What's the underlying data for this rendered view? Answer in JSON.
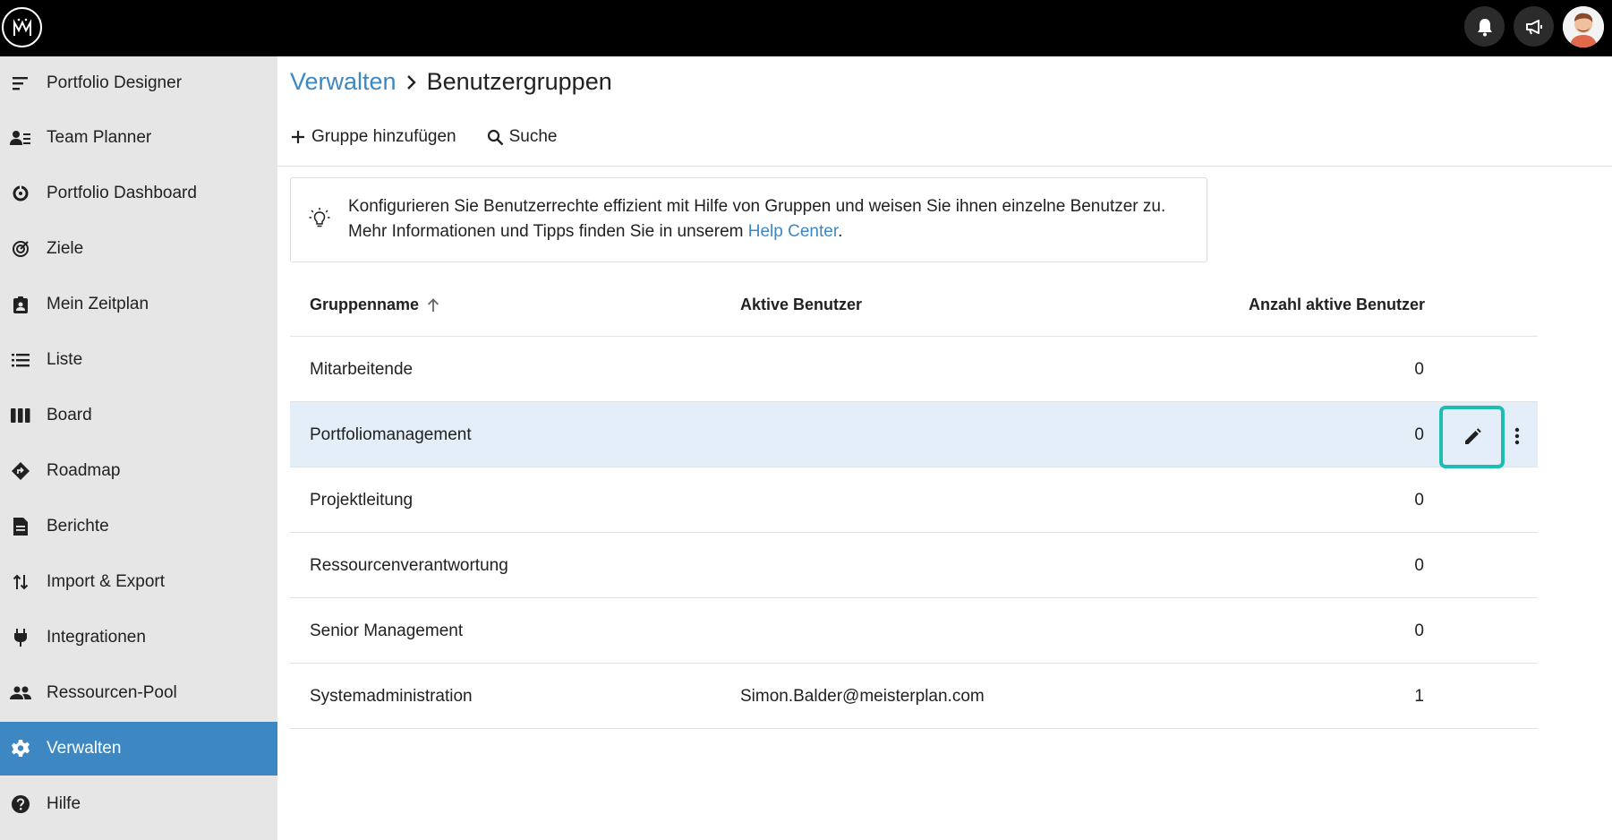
{
  "topbar": {
    "logo_icon": "meisterplan-logo-icon",
    "notifications_icon": "bell-icon",
    "announcements_icon": "megaphone-icon",
    "avatar_icon": "user-avatar"
  },
  "sidebar": {
    "items": [
      {
        "label": "Portfolio Designer",
        "icon": "portfolio-designer-icon"
      },
      {
        "label": "Team Planner",
        "icon": "team-planner-icon"
      },
      {
        "label": "Portfolio Dashboard",
        "icon": "dashboard-icon"
      },
      {
        "label": "Ziele",
        "icon": "target-icon"
      },
      {
        "label": "Mein Zeitplan",
        "icon": "schedule-icon"
      },
      {
        "label": "Liste",
        "icon": "list-icon"
      },
      {
        "label": "Board",
        "icon": "board-icon"
      },
      {
        "label": "Roadmap",
        "icon": "roadmap-icon"
      },
      {
        "label": "Berichte",
        "icon": "report-icon"
      },
      {
        "label": "Import & Export",
        "icon": "import-export-icon"
      },
      {
        "label": "Integrationen",
        "icon": "plug-icon"
      },
      {
        "label": "Ressourcen-Pool",
        "icon": "people-icon"
      },
      {
        "label": "Verwalten",
        "icon": "gear-icon",
        "active": true
      },
      {
        "label": "Hilfe",
        "icon": "help-icon"
      }
    ],
    "active_color": "#3d88c2"
  },
  "breadcrumb": {
    "parent": "Verwalten",
    "current": "Benutzergruppen"
  },
  "toolbar": {
    "add_label": "Gruppe hinzufügen",
    "search_label": "Suche"
  },
  "info": {
    "line1": "Konfigurieren Sie Benutzerrechte effizient mit Hilfe von Gruppen und weisen Sie ihnen einzelne Benutzer zu.",
    "line2_prefix": "Mehr Informationen und Tipps finden Sie in unserem ",
    "link_text": "Help Center",
    "line2_suffix": "."
  },
  "table": {
    "columns": {
      "name": "Gruppenname",
      "active_users": "Aktive Benutzer",
      "count": "Anzahl aktive Benutzer"
    },
    "sort": "ascending",
    "rows": [
      {
        "name": "Mitarbeitende",
        "active_users": "",
        "count": "0"
      },
      {
        "name": "Portfoliomanagement",
        "active_users": "",
        "count": "0",
        "highlighted": true
      },
      {
        "name": "Projektleitung",
        "active_users": "",
        "count": "0"
      },
      {
        "name": "Ressourcenverantwortung",
        "active_users": "",
        "count": "0"
      },
      {
        "name": "Senior Management",
        "active_users": "",
        "count": "0"
      },
      {
        "name": "Systemadministration",
        "active_users": "Simon.Balder@meisterplan.com",
        "count": "1"
      }
    ],
    "highlight_color": "#e3eef8",
    "focus_color": "#1ebdb1"
  }
}
